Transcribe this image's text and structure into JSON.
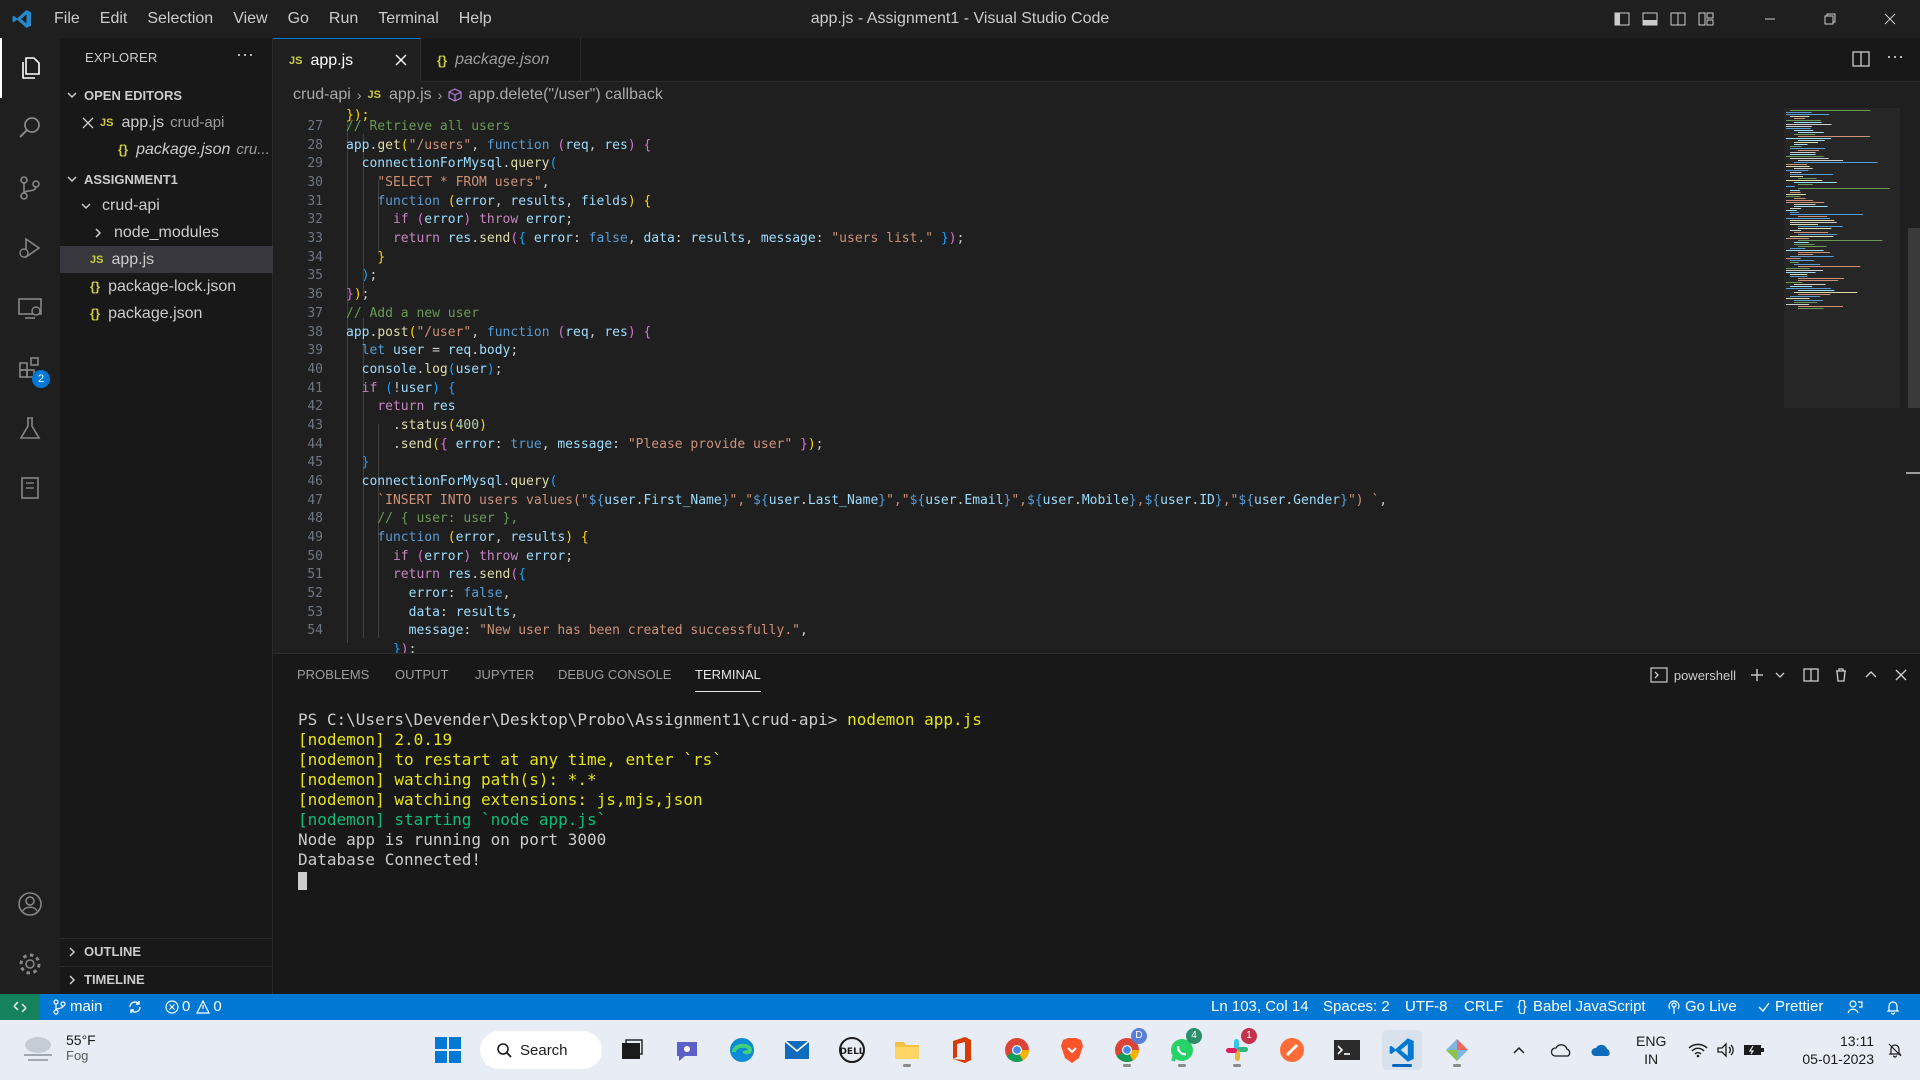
{
  "window": {
    "title": "app.js - Assignment1 - Visual Studio Code",
    "menu": [
      "File",
      "Edit",
      "Selection",
      "View",
      "Go",
      "Run",
      "Terminal",
      "Help"
    ]
  },
  "activity_bar": {
    "items": [
      "files-icon",
      "search-icon",
      "source-control-icon",
      "run-debug-icon",
      "remote-explorer-icon",
      "extensions-icon",
      "testing-icon",
      "notebook-icon"
    ],
    "extensions_badge": "2",
    "bottom": [
      "account-icon",
      "settings-gear-icon"
    ]
  },
  "sidebar": {
    "title": "EXPLORER",
    "more": "···",
    "open_editors": {
      "label": "OPEN EDITORS",
      "items": [
        {
          "badge": "JS",
          "name": "app.js",
          "folder": "crud-api"
        },
        {
          "badge": "{}",
          "name": "package.json",
          "folder": "cru..."
        }
      ]
    },
    "workspace": {
      "label": "ASSIGNMENT1",
      "folder": "crud-api",
      "items": [
        {
          "badge": "",
          "name": "node_modules"
        },
        {
          "badge": "JS",
          "name": "app.js"
        },
        {
          "badge": "{}",
          "name": "package-lock.json"
        },
        {
          "badge": "{}",
          "name": "package.json"
        }
      ]
    },
    "outline_label": "OUTLINE",
    "timeline_label": "TIMELINE"
  },
  "tabs": [
    {
      "badge": "JS",
      "label": "app.js"
    },
    {
      "badge": "{}",
      "label": "package.json"
    }
  ],
  "breadcrumb": {
    "folder": "crud-api",
    "file_badge": "JS",
    "file": "app.js",
    "symbol": "app.delete(\"/user\") callback"
  },
  "editor": {
    "line_numbers": [
      "27",
      "28",
      "29",
      "30",
      "31",
      "32",
      "33",
      "34",
      "35",
      "36",
      "37",
      "38",
      "39",
      "40",
      "41",
      "42",
      "43",
      "44",
      "45",
      "46",
      "47",
      "48",
      "49",
      "50",
      "51",
      "52",
      "53",
      "54"
    ]
  },
  "panel": {
    "tabs": [
      "PROBLEMS",
      "OUTPUT",
      "JUPYTER",
      "DEBUG CONSOLE",
      "TERMINAL"
    ],
    "shell": "powershell",
    "terminal": {
      "prompt": "PS C:\\Users\\Devender\\Desktop\\Probo\\Assignment1\\crud-api> ",
      "command": "nodemon app.js",
      "yellow_lines": [
        "[nodemon] 2.0.19",
        "[nodemon] to restart at any time, enter `rs`",
        "[nodemon] watching path(s): *.*",
        "[nodemon] watching extensions: js,mjs,json"
      ],
      "green_line": "[nodemon] starting `node app.js`",
      "output_lines": [
        "Node app is running on port 3000",
        "Database Connected!"
      ]
    }
  },
  "statusbar": {
    "branch": "main",
    "errors": "0",
    "warnings": "0",
    "position": "Ln 103, Col 14",
    "spaces": "Spaces: 2",
    "encoding": "UTF-8",
    "eol": "CRLF",
    "language": "Babel JavaScript",
    "golive": "Go Live",
    "prettier": "Prettier"
  },
  "taskbar": {
    "weather_temp": "55°F",
    "weather_desc": "Fog",
    "search": "Search",
    "chrome_badge": "D",
    "whatsapp_badge": "4",
    "slack_badge": "1",
    "lang_top": "ENG",
    "lang_bottom": "IN",
    "time": "13:11",
    "date": "05-01-2023"
  },
  "colors": {
    "accent": "#0078d4",
    "statusbar": "#0078d4",
    "remote": "#16825d",
    "js_badge": "#cbcb41"
  }
}
